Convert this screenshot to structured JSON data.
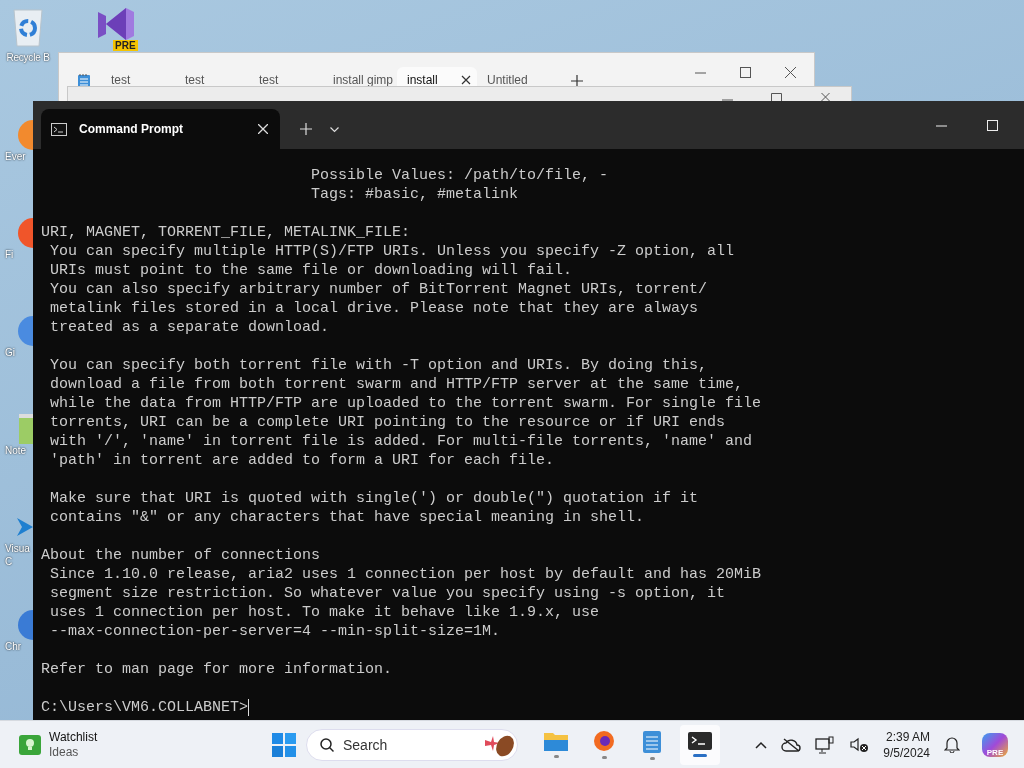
{
  "desktop": {
    "icons": [
      {
        "kind": "recycle-bin",
        "label": "Recycle B"
      },
      {
        "kind": "studio",
        "badge": "PRE"
      }
    ],
    "side_icons": [
      {
        "kind": "orange",
        "label": "Ever"
      },
      {
        "kind": "firefox",
        "label": "Fi"
      },
      {
        "kind": "blue",
        "label": "Gi"
      },
      {
        "kind": "notepad",
        "label": "Note"
      },
      {
        "kind": "vscode",
        "label": "Visua",
        "label_2": "C"
      },
      {
        "kind": "chrome",
        "label": "Chr"
      }
    ]
  },
  "notepad": {
    "tabs": [
      {
        "label": "test",
        "selected": false
      },
      {
        "label": "test",
        "selected": false
      },
      {
        "label": "test",
        "selected": false
      },
      {
        "label": "install gimp",
        "selected": false
      },
      {
        "label": "install",
        "selected": true
      },
      {
        "label": "Untitled",
        "selected": false
      }
    ]
  },
  "terminal": {
    "tabs": [
      {
        "title": "Command Prompt",
        "selected": true
      }
    ],
    "output": [
      {
        "lines": [
          "                              Possible Values: /path/to/file, -",
          "                              Tags: #basic, #metalink"
        ]
      },
      {
        "lines": [
          "URI, MAGNET, TORRENT_FILE, METALINK_FILE:",
          " You can specify multiple HTTP(S)/FTP URIs. Unless you specify -Z option, all",
          " URIs must point to the same file or downloading will fail.",
          " You can also specify arbitrary number of BitTorrent Magnet URIs, torrent/",
          " metalink files stored in a local drive. Please note that they are always",
          " treated as a separate download."
        ]
      },
      {
        "lines": [
          " You can specify both torrent file with -T option and URIs. By doing this,",
          " download a file from both torrent swarm and HTTP/FTP server at the same time,",
          " while the data from HTTP/FTP are uploaded to the torrent swarm. For single file",
          " torrents, URI can be a complete URI pointing to the resource or if URI ends",
          " with '/', 'name' in torrent file is added. For multi-file torrents, 'name' and",
          " 'path' in torrent are added to form a URI for each file."
        ]
      },
      {
        "lines": [
          " Make sure that URI is quoted with single(') or double(\") quotation if it",
          " contains \"&\" or any characters that have special meaning in shell."
        ]
      },
      {
        "lines": [
          "About the number of connections",
          " Since 1.10.0 release, aria2 uses 1 connection per host by default and has 20MiB",
          " segment size restriction. So whatever value you specify using -s option, it",
          " uses 1 connection per host. To make it behave like 1.9.x, use",
          " --max-connection-per-server=4 --min-split-size=1M."
        ]
      },
      {
        "lines": [
          "Refer to man page for more information."
        ]
      }
    ],
    "prompt": "C:\\Users\\VM6.COLLABNET>"
  },
  "taskbar": {
    "widget": {
      "title": "Watchlist",
      "subtitle": "Ideas"
    },
    "search": {
      "placeholder": "Search"
    },
    "apps": [
      {
        "kind": "explorer",
        "selected": false
      },
      {
        "kind": "firefox",
        "selected": false
      },
      {
        "kind": "notepad",
        "selected": false
      },
      {
        "kind": "terminal",
        "selected": true
      }
    ],
    "time": "2:39 AM",
    "date": "9/5/2024",
    "copilot_badge": "PRE"
  }
}
